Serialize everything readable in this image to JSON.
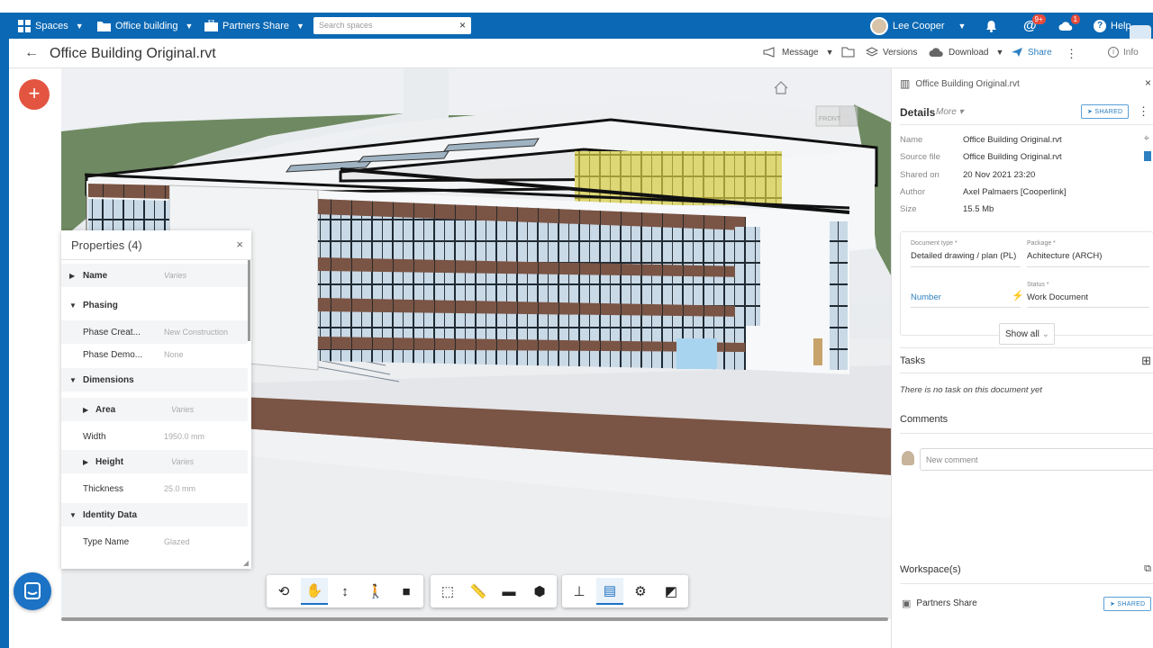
{
  "topbar": {
    "spaces": "Spaces",
    "office": "Office building",
    "partners": "Partners Share",
    "search_placeholder": "Search spaces",
    "user": "Lee Cooper",
    "mentions_badge": "9+",
    "notif_badge": "1",
    "help": "Help"
  },
  "titlebar": {
    "title": "Office Building Original.rvt",
    "message": "Message",
    "versions": "Versions",
    "download": "Download",
    "share": "Share",
    "info": "Info"
  },
  "properties": {
    "title": "Properties (4)",
    "rows": [
      {
        "label": "Name",
        "value": "Varies"
      },
      {
        "label": "Phasing",
        "value": ""
      },
      {
        "label": "Phase Creat...",
        "value": "New Construction"
      },
      {
        "label": "Phase Demo...",
        "value": "None"
      },
      {
        "label": "Dimensions",
        "value": ""
      },
      {
        "label": "Area",
        "value": "Varies"
      },
      {
        "label": "Width",
        "value": "1950.0 mm"
      },
      {
        "label": "Height",
        "value": "Varies"
      },
      {
        "label": "Thickness",
        "value": "25.0 mm"
      },
      {
        "label": "Identity Data",
        "value": ""
      },
      {
        "label": "Type Name",
        "value": "Glazed"
      }
    ]
  },
  "details": {
    "file_name": "Office Building Original.rvt",
    "heading": "Details",
    "more": "More",
    "shared": "SHARED",
    "name_label": "Name",
    "name_value": "Office Building Original.rvt",
    "source_label": "Source file",
    "source_value": "Office Building Original.rvt",
    "shared_on_label": "Shared on",
    "shared_on_value": "20 Nov 2021 23:20",
    "author_label": "Author",
    "author_value": "Axel Palmaers [Cooperlink]",
    "size_label": "Size",
    "size_value": "15.5 Mb",
    "doc_type_label": "Document type *",
    "doc_type_value": "Detailed drawing / plan (PL)",
    "package_label": "Package *",
    "package_value": "Achitecture (ARCH)",
    "number_value": "Number",
    "status_label": "Status *",
    "status_value": "Work Document",
    "show_all": "Show all"
  },
  "tasks": {
    "title": "Tasks",
    "empty": "There is no task on this document yet"
  },
  "comments": {
    "title": "Comments",
    "placeholder": "New comment"
  },
  "workspaces": {
    "title": "Workspace(s)",
    "item": "Partners Share",
    "shared": "SHARED"
  }
}
